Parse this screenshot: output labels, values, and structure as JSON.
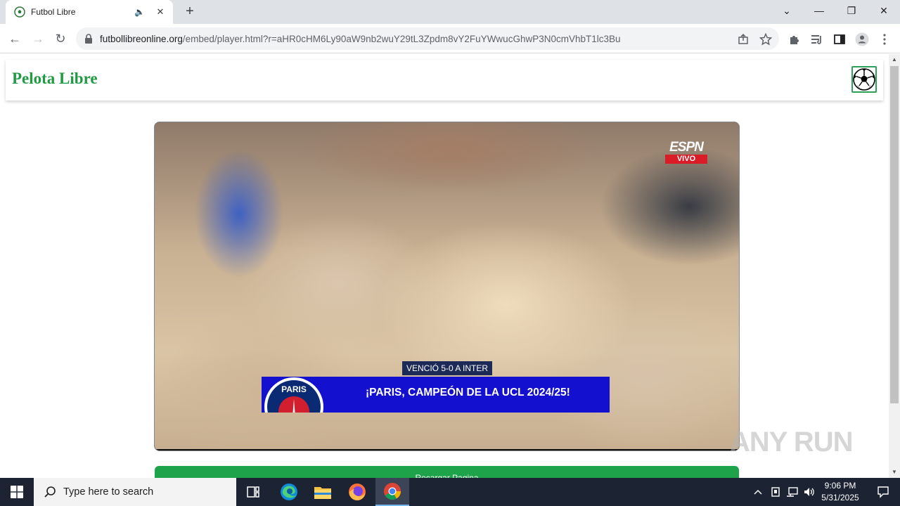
{
  "browser": {
    "tab": {
      "title": "Futbol Libre",
      "audio_glyph": "🔈",
      "close_glyph": "✕"
    },
    "new_tab_glyph": "+",
    "window": {
      "minimize": "—",
      "restore": "❐",
      "close": "✕",
      "tab_search": "⌄"
    },
    "url": {
      "host": "futbollibreonline.org",
      "path": "/embed/player.html?r=aHR0cHM6Ly90aW9nb2wuY29tL3Zpdm8vY2FuYWwucGhwP3N0cmVhbT1lc3Bu"
    },
    "nav": {
      "back": "←",
      "forward": "→",
      "reload": "↻"
    }
  },
  "site": {
    "brand": "Pelota Libre",
    "menu_icon": "soccer-ball-icon"
  },
  "player": {
    "network_logo": "ESPN",
    "live_badge": "VIVO",
    "lower_third_sub": "VENCIÓ 5-0 A INTER",
    "lower_third_main": "¡PARIS, CAMPEÓN DE LA UCL 2024/25!",
    "crest_text": "PARIS"
  },
  "reload_button": "Recargar Pagina",
  "watermark": "ANY RUN",
  "taskbar": {
    "search_placeholder": "Type here to search",
    "time": "9:06 PM",
    "date": "5/31/2025",
    "apps": [
      "task-view",
      "edge",
      "file-explorer",
      "firefox",
      "chrome"
    ]
  },
  "colors": {
    "brand_green": "#229944",
    "button_green": "#1ea34a",
    "taskbar": "#1c2333",
    "live_red": "#d91c25",
    "banner_blue": "#1410d0"
  }
}
